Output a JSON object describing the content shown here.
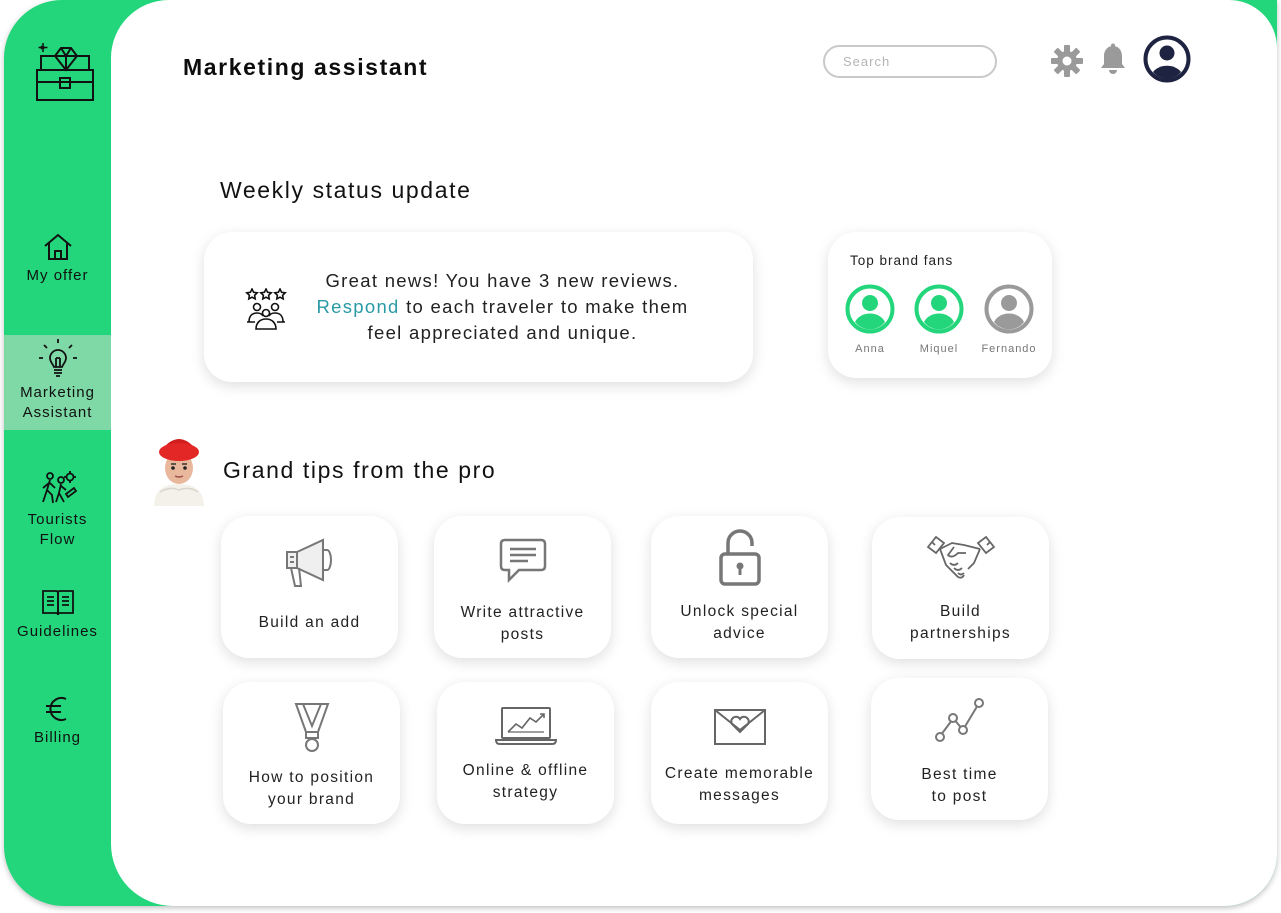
{
  "app": {
    "title": "Marketing assistant"
  },
  "sidebar": {
    "items": [
      {
        "label_line1": "My offer",
        "label_line2": "",
        "icon": "home-icon"
      },
      {
        "label_line1": "Marketing",
        "label_line2": "Assistant",
        "icon": "lightbulb-icon",
        "active": true
      },
      {
        "label_line1": "Tourists",
        "label_line2": "Flow",
        "icon": "tourists-icon"
      },
      {
        "label_line1": "Guidelines",
        "label_line2": "",
        "icon": "book-icon"
      },
      {
        "label_line1": "Billing",
        "label_line2": "",
        "icon": "euro-icon"
      }
    ]
  },
  "header": {
    "search_placeholder": "Search",
    "icons": [
      "gear-icon",
      "bell-icon",
      "user-account-icon"
    ]
  },
  "weekly": {
    "title": "Weekly status update",
    "line1": "Great news! You have 3 new reviews.",
    "link": "Respond",
    "line2_rest": " to each traveler to make them",
    "line3": "feel appreciated and unique."
  },
  "fans": {
    "title": "Top brand fans",
    "people": [
      {
        "name": "Anna",
        "color": "#23d67b"
      },
      {
        "name": "Miquel",
        "color": "#23d67b"
      },
      {
        "name": "Fernando",
        "color": "#9a9a9a"
      }
    ]
  },
  "tips": {
    "title": "Grand tips from the pro",
    "items": [
      {
        "line1": "Build an add",
        "line2": "",
        "icon": "megaphone-icon"
      },
      {
        "line1": "Write attractive",
        "line2": "posts",
        "icon": "chat-bubble-icon"
      },
      {
        "line1": "Unlock special",
        "line2": "advice",
        "icon": "unlock-icon"
      },
      {
        "line1": "Build",
        "line2": "partnerships",
        "icon": "handshake-icon"
      },
      {
        "line1": "How to position",
        "line2": "your brand",
        "icon": "medal-icon"
      },
      {
        "line1": "Online & offline",
        "line2": "strategy",
        "icon": "laptop-chart-icon"
      },
      {
        "line1": "Create memorable",
        "line2": "messages",
        "icon": "envelope-heart-icon"
      },
      {
        "line1": "Best time",
        "line2": "to post",
        "icon": "line-chart-icon"
      }
    ]
  },
  "colors": {
    "brand_green": "#23d67b",
    "active_nav": "#7fd9a6",
    "link": "#2a9aa5",
    "icon_gray": "#9a9a9a",
    "navy": "#1d2340"
  }
}
